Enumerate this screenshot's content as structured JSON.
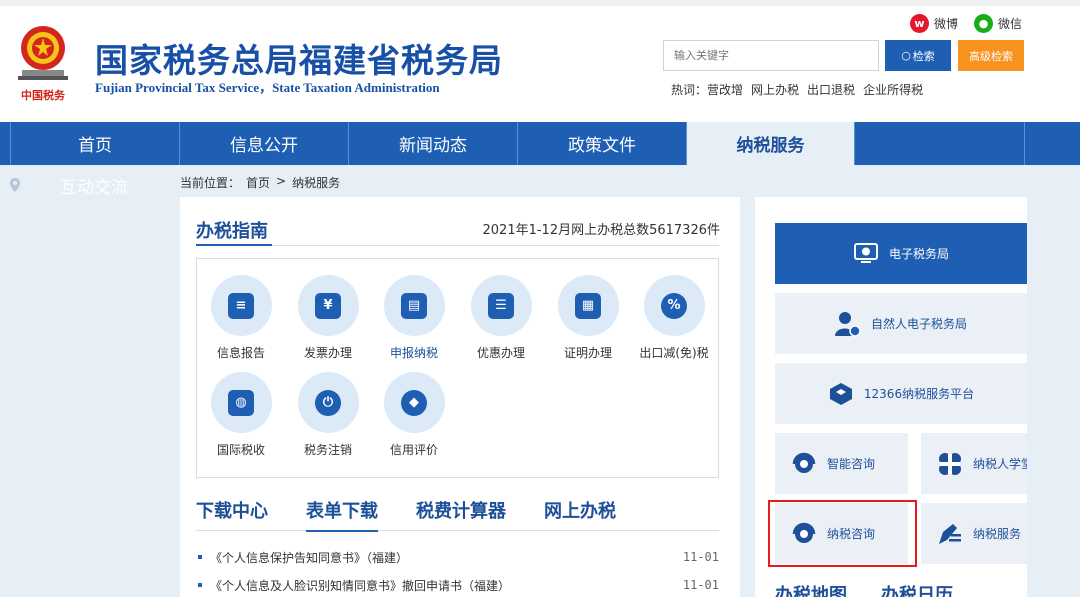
{
  "header": {
    "title": "国家税务总局福建省税务局",
    "subtitle": "Fujian Provincial Tax Service，State Taxation Administration",
    "logo_text": "中国税务",
    "social": {
      "weibo": "微博",
      "wechat": "微信"
    },
    "search": {
      "placeholder": "输入关键字",
      "button": "检索",
      "advanced": "高级检索"
    },
    "hotwords_label": "热词：",
    "hotwords": [
      "营改增",
      "网上办税",
      "出口退税",
      "企业所得税"
    ]
  },
  "nav": {
    "items": [
      "首页",
      "信息公开",
      "新闻动态",
      "政策文件",
      "纳税服务"
    ],
    "active": "纳税服务"
  },
  "sidebar": {
    "label": "互动交流"
  },
  "breadcrumb": {
    "label": "当前位置：",
    "home": "首页",
    "sep": ">",
    "current": "纳税服务"
  },
  "guide": {
    "title": "办税指南",
    "count": "2021年1-12月网上办税总数5617326件",
    "services": [
      {
        "name": "信息报告",
        "icon": "document-icon",
        "glyph": "≡"
      },
      {
        "name": "发票办理",
        "icon": "invoice-icon",
        "glyph": "¥"
      },
      {
        "name": "申报纳税",
        "icon": "declare-icon",
        "glyph": "▤"
      },
      {
        "name": "优惠办理",
        "icon": "discount-icon",
        "glyph": "☰"
      },
      {
        "name": "证明办理",
        "icon": "certificate-icon",
        "glyph": "▦"
      },
      {
        "name": "出口减(免)税",
        "icon": "percent-icon",
        "glyph": "%"
      },
      {
        "name": "国际税收",
        "icon": "globe-icon",
        "glyph": "◍"
      },
      {
        "name": "税务注销",
        "icon": "power-icon",
        "glyph": "⏻"
      },
      {
        "name": "信用评价",
        "icon": "diamond-icon",
        "glyph": "◆"
      }
    ]
  },
  "tabs": [
    "下载中心",
    "表单下载",
    "税费计算器",
    "网上办税"
  ],
  "active_tab": "表单下载",
  "documents": [
    {
      "title": "《个人信息保护告知同意书》（福建）",
      "date": "11-01"
    },
    {
      "title": "《个人信息及人脸识别知情同意书》撤回申请书（福建）",
      "date": "11-01"
    }
  ],
  "right_panel": {
    "etax": "电子税务局",
    "natural_person": "自然人电子税务局",
    "service_12366": "12366纳税服务平台",
    "smart_consult": "智能咨询",
    "taxpayer_school": "纳税人学堂",
    "tax_consult": "纳税咨询",
    "tax_service": "纳税服务",
    "bottom_tabs": [
      "办税地图",
      "办税日历"
    ]
  },
  "colors": {
    "brand": "#1e5fb4",
    "advanced": "#f7931e",
    "highlight": "#e31b1b"
  }
}
